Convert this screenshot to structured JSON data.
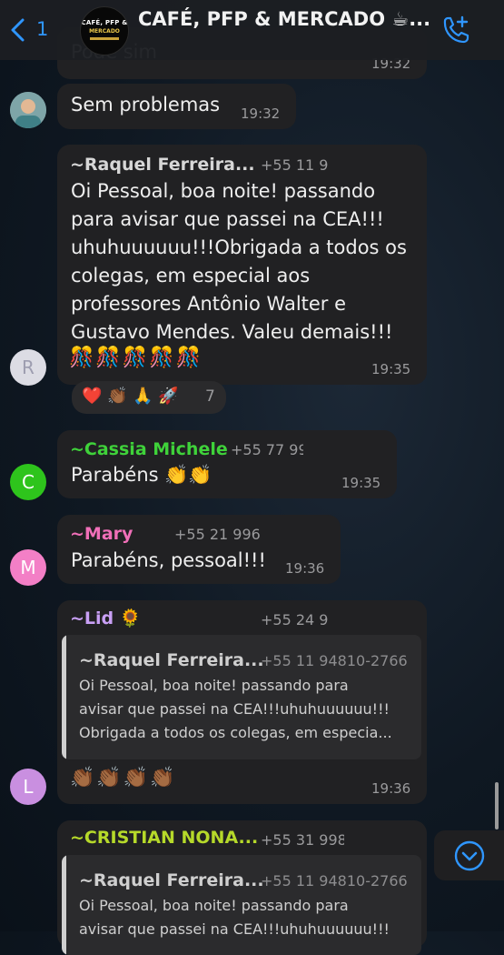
{
  "header": {
    "back_count": "1",
    "title": "CAFÉ, PFP & MERCADO ☕...",
    "avatar_logo_line1": "CAFÉ, PFP &",
    "avatar_logo_line2": "MERCADO"
  },
  "messages": [
    {
      "text": "Pode sim",
      "time": "19:32"
    },
    {
      "text": "Sem problemas",
      "time": "19:32"
    },
    {
      "author": "~Raquel Ferreira...",
      "phone": "+55 11 9",
      "lines": [
        "Oi Pessoal, boa noite! passando",
        "para avisar que passei na CEA!!!",
        "uhuhuuuuuu!!!Obrigada a todos os",
        "colegas, em especial aos",
        "professores Antônio Walter e",
        "Gustavo Mendes. Valeu demais!!!"
      ],
      "emojis": "🎊🎊🎊🎊🎊",
      "time": "19:35",
      "avatar_initial": "R",
      "reactions": "❤️ 👏🏾 🙏 🚀",
      "reaction_count": "7"
    },
    {
      "author": "~Cassia Michele",
      "phone": "+55 77 99",
      "text": "Parabéns 👏👏",
      "time": "19:35",
      "avatar_initial": "C"
    },
    {
      "author": "~Mary",
      "phone": "+55 21 996",
      "text": "Parabéns, pessoal!!!",
      "time": "19:36",
      "avatar_initial": "M"
    },
    {
      "author": "~Lid 🌻",
      "phone": "+55 24 9",
      "quote_author": "~Raquel Ferreira...",
      "quote_phone": "+55 11 94810-2766",
      "quote_lines": [
        "Oi Pessoal, boa noite! passando para",
        "avisar que passei na CEA!!!uhuhuuuuuu!!!",
        "Obrigada a todos os colegas, em especia..."
      ],
      "emojis": "👏🏾👏🏾👏🏾👏🏾",
      "time": "19:36",
      "avatar_initial": "L"
    },
    {
      "author": "~CRISTIAN NONA...",
      "phone": "+55 31 998",
      "quote_author": "~Raquel Ferreira...",
      "quote_phone": "+55 11 94810-2766",
      "quote_lines": [
        "Oi Pessoal, boa noite! passando para",
        "avisar que passei na CEA!!!uhuhuuuuuu!!!"
      ]
    }
  ],
  "colors": {
    "header_accent": "#2f96ff",
    "cassia_name": "#3fd23a",
    "mary_name": "#f06fb8",
    "lid_name": "#c9a0f5",
    "cristian_name": "#b6d92a",
    "raquel_name": "#d7d7d7"
  },
  "icons": [
    "back-chevron-icon",
    "phone-plus-icon",
    "chevron-down-circle-icon"
  ]
}
